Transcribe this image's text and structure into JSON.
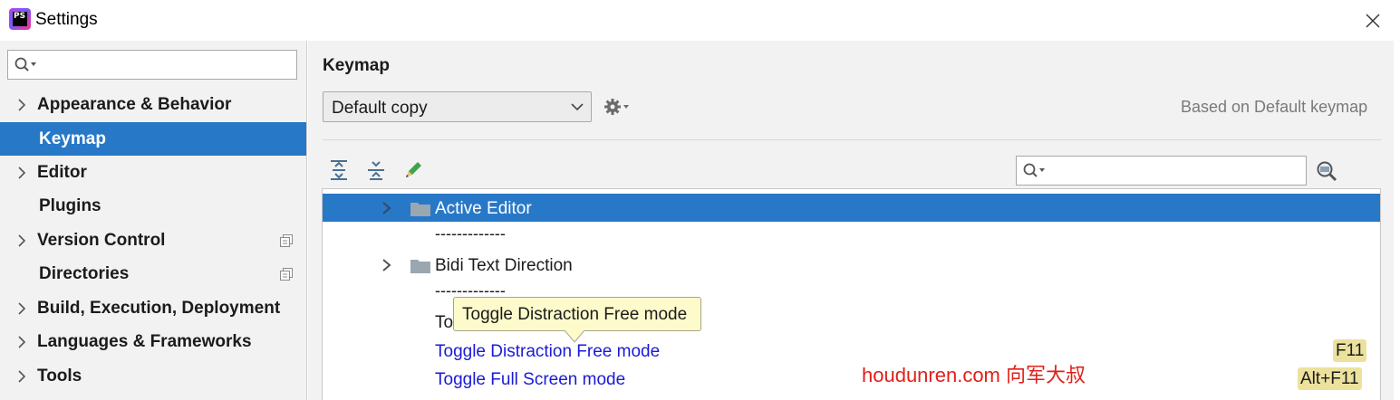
{
  "window": {
    "title": "Settings",
    "app_icon_text": "PS",
    "close_icon": "close-icon"
  },
  "sidebar": {
    "search": {
      "value": "",
      "placeholder": ""
    },
    "items": [
      {
        "label": "Appearance & Behavior",
        "expandable": true,
        "selected": false
      },
      {
        "label": "Keymap",
        "expandable": false,
        "selected": true
      },
      {
        "label": "Editor",
        "expandable": true,
        "selected": false
      },
      {
        "label": "Plugins",
        "expandable": false,
        "selected": false
      },
      {
        "label": "Version Control",
        "expandable": true,
        "selected": false,
        "project_icon": true
      },
      {
        "label": "Directories",
        "expandable": false,
        "selected": false,
        "project_icon": true
      },
      {
        "label": "Build, Execution, Deployment",
        "expandable": true,
        "selected": false
      },
      {
        "label": "Languages & Frameworks",
        "expandable": true,
        "selected": false
      },
      {
        "label": "Tools",
        "expandable": true,
        "selected": false
      }
    ]
  },
  "main": {
    "title": "Keymap",
    "keymap_select": {
      "value": "Default copy"
    },
    "based_on": "Based on Default keymap",
    "toolbar": {
      "expand_all_icon": "expand-all-icon",
      "collapse_all_icon": "collapse-all-icon",
      "edit_icon": "edit-icon",
      "search": {
        "value": "",
        "placeholder": ""
      },
      "find_shortcut_icon": "find-by-shortcut-icon"
    },
    "tree": [
      {
        "type": "folder",
        "label": "Active Editor",
        "selected": true
      },
      {
        "type": "separator",
        "label": "-------------"
      },
      {
        "type": "folder",
        "label": "Bidi Text Direction",
        "selected": false
      },
      {
        "type": "separator",
        "label": "-------------"
      },
      {
        "type": "action",
        "label": "Togg",
        "partial": true
      },
      {
        "type": "action",
        "label": "Toggle Distraction Free mode",
        "shortcut": "F11"
      },
      {
        "type": "action",
        "label": "Toggle Full Screen mode",
        "shortcut": "Alt+F11"
      }
    ],
    "tooltip": "Toggle Distraction Free mode"
  },
  "watermark": "houdunren.com 向军大叔",
  "colors": {
    "selection": "#2878c8",
    "action_link": "#1a1ad6",
    "shortcut_bg": "#ece29e",
    "tooltip_bg": "#fdfbcb",
    "watermark": "#e0201a"
  }
}
